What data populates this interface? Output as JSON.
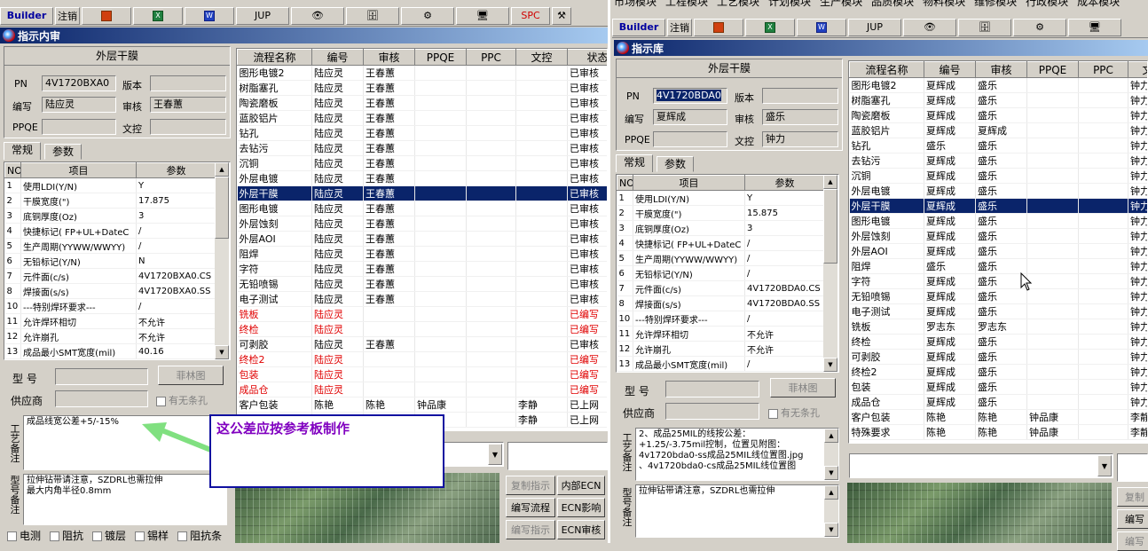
{
  "left": {
    "toolbar": {
      "builder": "Builder",
      "logout": "注销",
      "jup": "JUP",
      "spc": "SPC"
    },
    "window_title": "指示内审",
    "header_title": "外层干膜",
    "fields": {
      "pn_label": "PN",
      "pn_value": "4V1720BXA0",
      "version_label": "版本",
      "version_value": "",
      "writer_label": "编写",
      "writer_value": "陆应灵",
      "reviewer_label": "审核",
      "reviewer_value": "王春蕙",
      "ppqe_label": "PPQE",
      "ppqe_value": "",
      "doccontrol_label": "文控",
      "doccontrol_value": ""
    },
    "tabs": [
      "常规",
      "参数"
    ],
    "param_headers": [
      "NO",
      "项目",
      "参数"
    ],
    "params": [
      [
        "1",
        "使用LDI(Y/N)",
        "Y"
      ],
      [
        "2",
        "干膜宽度(\")",
        "17.875"
      ],
      [
        "3",
        "底铜厚度(Oz)",
        "3"
      ],
      [
        "4",
        "快捷标记( FP+UL+DateC",
        "/"
      ],
      [
        "5",
        "生产周期(YYWW/WWYY)",
        "/"
      ],
      [
        "6",
        "无铅标记(Y/N)",
        "N"
      ],
      [
        "7",
        "元件面(c/s)",
        "4V1720BXA0.CS"
      ],
      [
        "8",
        "焊接面(s/s)",
        "4V1720BXA0.SS"
      ],
      [
        "10",
        "---特别焊环要求---",
        "/"
      ],
      [
        "11",
        "允许焊环相切",
        "不允许"
      ],
      [
        "12",
        "允许崩孔",
        "不允许"
      ],
      [
        "13",
        "成品最小SMT宽度(mil)",
        "40.16"
      ]
    ],
    "model_label": "型 号",
    "model_value": "",
    "felin_button": "菲林图",
    "supplier_label": "供应商",
    "supplier_value": "",
    "nobar_label": "有无条孔",
    "process_note_label": "工艺备注",
    "process_note": "成品线宽公差+5/-15%",
    "model_note_label": "型号备注",
    "model_note": "拉伸钻带请注意，SZDRL也需拉伸\n最大内角半径0.8mm",
    "checkboxes": [
      "电测",
      "阻抗",
      "镀层",
      "锡样",
      "阻抗条"
    ],
    "flow_headers": [
      "流程名称",
      "编号",
      "审核",
      "PPQE",
      "PPC",
      "文控",
      "状态"
    ],
    "flow_rows": [
      {
        "cells": [
          "图形电镀2",
          "陆应灵",
          "王春蕙",
          "",
          "",
          "",
          "已审核"
        ],
        "state": "normal"
      },
      {
        "cells": [
          "树脂塞孔",
          "陆应灵",
          "王春蕙",
          "",
          "",
          "",
          "已审核"
        ],
        "state": "normal"
      },
      {
        "cells": [
          "陶瓷磨板",
          "陆应灵",
          "王春蕙",
          "",
          "",
          "",
          "已审核"
        ],
        "state": "normal"
      },
      {
        "cells": [
          "蓝胶铝片",
          "陆应灵",
          "王春蕙",
          "",
          "",
          "",
          "已审核"
        ],
        "state": "normal"
      },
      {
        "cells": [
          "钻孔",
          "陆应灵",
          "王春蕙",
          "",
          "",
          "",
          "已审核"
        ],
        "state": "normal"
      },
      {
        "cells": [
          "去钻污",
          "陆应灵",
          "王春蕙",
          "",
          "",
          "",
          "已审核"
        ],
        "state": "normal"
      },
      {
        "cells": [
          "沉铜",
          "陆应灵",
          "王春蕙",
          "",
          "",
          "",
          "已审核"
        ],
        "state": "normal"
      },
      {
        "cells": [
          "外层电镀",
          "陆应灵",
          "王春蕙",
          "",
          "",
          "",
          "已审核"
        ],
        "state": "normal"
      },
      {
        "cells": [
          "外层干膜",
          "陆应灵",
          "王春蕙",
          "",
          "",
          "",
          "已审核"
        ],
        "state": "selected"
      },
      {
        "cells": [
          "图形电镀",
          "陆应灵",
          "王春蕙",
          "",
          "",
          "",
          "已审核"
        ],
        "state": "normal"
      },
      {
        "cells": [
          "外层蚀刻",
          "陆应灵",
          "王春蕙",
          "",
          "",
          "",
          "已审核"
        ],
        "state": "normal"
      },
      {
        "cells": [
          "外层AOI",
          "陆应灵",
          "王春蕙",
          "",
          "",
          "",
          "已审核"
        ],
        "state": "normal"
      },
      {
        "cells": [
          "阻焊",
          "陆应灵",
          "王春蕙",
          "",
          "",
          "",
          "已审核"
        ],
        "state": "normal"
      },
      {
        "cells": [
          "字符",
          "陆应灵",
          "王春蕙",
          "",
          "",
          "",
          "已审核"
        ],
        "state": "normal"
      },
      {
        "cells": [
          "无铅喷锡",
          "陆应灵",
          "王春蕙",
          "",
          "",
          "",
          "已审核"
        ],
        "state": "normal"
      },
      {
        "cells": [
          "电子测试",
          "陆应灵",
          "王春蕙",
          "",
          "",
          "",
          "已审核"
        ],
        "state": "normal"
      },
      {
        "cells": [
          "铣板",
          "陆应灵",
          "",
          "",
          "",
          "",
          "已编写"
        ],
        "state": "red"
      },
      {
        "cells": [
          "终检",
          "陆应灵",
          "",
          "",
          "",
          "",
          "已编写"
        ],
        "state": "red"
      },
      {
        "cells": [
          "可剥胶",
          "陆应灵",
          "王春蕙",
          "",
          "",
          "",
          "已审核"
        ],
        "state": "normal"
      },
      {
        "cells": [
          "终检2",
          "陆应灵",
          "",
          "",
          "",
          "",
          "已编写"
        ],
        "state": "red"
      },
      {
        "cells": [
          "包装",
          "陆应灵",
          "",
          "",
          "",
          "",
          "已编写"
        ],
        "state": "red"
      },
      {
        "cells": [
          "成品仓",
          "陆应灵",
          "",
          "",
          "",
          "",
          "已编写"
        ],
        "state": "red"
      },
      {
        "cells": [
          "客户包装",
          "陈艳",
          "陈艳",
          "钟品康",
          "",
          "李静",
          "已上网"
        ],
        "state": "normal"
      },
      {
        "cells": [
          "",
          "",
          "",
          "",
          "",
          "李静",
          "已上网"
        ],
        "state": "normal"
      }
    ],
    "buttons": [
      "复制指示",
      "内部ECN",
      "编写流程",
      "ECN影响",
      "编写指示",
      "ECN审核"
    ]
  },
  "callout_text": "这公差应按参考板制作",
  "right": {
    "top_menu": [
      "市场模块",
      "工程模块",
      "工艺模块",
      "计划模块",
      "生产模块",
      "品质模块",
      "物料模块",
      "维修模块",
      "行政模块",
      "成本模块"
    ],
    "toolbar": {
      "builder": "Builder",
      "logout": "注销",
      "jup": "JUP"
    },
    "window_title": "指示库",
    "header_title": "外层干膜",
    "fields": {
      "pn_label": "PN",
      "pn_value": "4V1720BDA0",
      "version_label": "版本",
      "version_value": "",
      "writer_label": "编写",
      "writer_value": "夏辉成",
      "reviewer_label": "审核",
      "reviewer_value": "盛乐",
      "ppqe_label": "PPQE",
      "ppqe_value": "",
      "doccontrol_label": "文控",
      "doccontrol_value": "钟力"
    },
    "tabs": [
      "常规",
      "参数"
    ],
    "param_headers": [
      "NO",
      "项目",
      "参数"
    ],
    "params": [
      [
        "1",
        "使用LDI(Y/N)",
        "Y"
      ],
      [
        "2",
        "干膜宽度(\")",
        "15.875"
      ],
      [
        "3",
        "底铜厚度(Oz)",
        "3"
      ],
      [
        "4",
        "快捷标记( FP+UL+DateC",
        "/"
      ],
      [
        "5",
        "生产周期(YYWW/WWYY)",
        "/"
      ],
      [
        "6",
        "无铅标记(Y/N)",
        "/"
      ],
      [
        "7",
        "元件面(c/s)",
        "4V1720BDA0.CS"
      ],
      [
        "8",
        "焊接面(s/s)",
        "4V1720BDA0.SS"
      ],
      [
        "10",
        "---特别焊环要求---",
        "/"
      ],
      [
        "11",
        "允许焊环相切",
        "不允许"
      ],
      [
        "12",
        "允许崩孔",
        "不允许"
      ],
      [
        "13",
        "成品最小SMT宽度(mil)",
        "/"
      ]
    ],
    "model_label": "型 号",
    "felin_button": "菲林图",
    "supplier_label": "供应商",
    "nobar_label": "有无条孔",
    "process_note_label": "工艺备注",
    "process_note": "2、成品25MIL的线按公差：\n+1.25/-3.75mil控制，位置见附图：\n4v1720bda0-ss成品25MIL线位置图.jpg\n、4v1720bda0-cs成品25MIL线位置图",
    "model_note_label": "型号备注",
    "model_note": "拉伸钻带请注意，SZDRL也需拉伸",
    "flow_headers": [
      "流程名称",
      "编号",
      "审核",
      "PPQE",
      "PPC",
      "文控"
    ],
    "flow_rows": [
      {
        "cells": [
          "图形电镀2",
          "夏辉成",
          "盛乐",
          "",
          "",
          "钟力"
        ],
        "state": "normal"
      },
      {
        "cells": [
          "树脂塞孔",
          "夏辉成",
          "盛乐",
          "",
          "",
          "钟力"
        ],
        "state": "normal"
      },
      {
        "cells": [
          "陶瓷磨板",
          "夏辉成",
          "盛乐",
          "",
          "",
          "钟力"
        ],
        "state": "normal"
      },
      {
        "cells": [
          "蓝胶铝片",
          "夏辉成",
          "夏辉成",
          "",
          "",
          "钟力"
        ],
        "state": "normal"
      },
      {
        "cells": [
          "钻孔",
          "盛乐",
          "盛乐",
          "",
          "",
          "钟力"
        ],
        "state": "normal"
      },
      {
        "cells": [
          "去钻污",
          "夏辉成",
          "盛乐",
          "",
          "",
          "钟力"
        ],
        "state": "normal"
      },
      {
        "cells": [
          "沉铜",
          "夏辉成",
          "盛乐",
          "",
          "",
          "钟力"
        ],
        "state": "normal"
      },
      {
        "cells": [
          "外层电镀",
          "夏辉成",
          "盛乐",
          "",
          "",
          "钟力"
        ],
        "state": "normal"
      },
      {
        "cells": [
          "外层干膜",
          "夏辉成",
          "盛乐",
          "",
          "",
          "钟力"
        ],
        "state": "selected"
      },
      {
        "cells": [
          "图形电镀",
          "夏辉成",
          "盛乐",
          "",
          "",
          "钟力"
        ],
        "state": "normal"
      },
      {
        "cells": [
          "外层蚀刻",
          "夏辉成",
          "盛乐",
          "",
          "",
          "钟力"
        ],
        "state": "normal"
      },
      {
        "cells": [
          "外层AOI",
          "夏辉成",
          "盛乐",
          "",
          "",
          "钟力"
        ],
        "state": "normal"
      },
      {
        "cells": [
          "阻焊",
          "盛乐",
          "盛乐",
          "",
          "",
          "钟力"
        ],
        "state": "normal"
      },
      {
        "cells": [
          "字符",
          "夏辉成",
          "盛乐",
          "",
          "",
          "钟力"
        ],
        "state": "normal"
      },
      {
        "cells": [
          "无铅喷锡",
          "夏辉成",
          "盛乐",
          "",
          "",
          "钟力"
        ],
        "state": "normal"
      },
      {
        "cells": [
          "电子测试",
          "夏辉成",
          "盛乐",
          "",
          "",
          "钟力"
        ],
        "state": "normal"
      },
      {
        "cells": [
          "铣板",
          "罗志东",
          "罗志东",
          "",
          "",
          "钟力"
        ],
        "state": "normal"
      },
      {
        "cells": [
          "终检",
          "夏辉成",
          "盛乐",
          "",
          "",
          "钟力"
        ],
        "state": "normal"
      },
      {
        "cells": [
          "可剥胶",
          "夏辉成",
          "盛乐",
          "",
          "",
          "钟力"
        ],
        "state": "normal"
      },
      {
        "cells": [
          "终检2",
          "夏辉成",
          "盛乐",
          "",
          "",
          "钟力"
        ],
        "state": "normal"
      },
      {
        "cells": [
          "包装",
          "夏辉成",
          "盛乐",
          "",
          "",
          "钟力"
        ],
        "state": "normal"
      },
      {
        "cells": [
          "成品仓",
          "夏辉成",
          "盛乐",
          "",
          "",
          "钟力"
        ],
        "state": "normal"
      },
      {
        "cells": [
          "客户包装",
          "陈艳",
          "陈艳",
          "钟品康",
          "",
          "李静"
        ],
        "state": "normal"
      },
      {
        "cells": [
          "特殊要求",
          "陈艳",
          "陈艳",
          "钟品康",
          "",
          "李静"
        ],
        "state": "normal"
      }
    ],
    "buttons": [
      "复制",
      "编写",
      "编写"
    ]
  },
  "colors": {
    "selection": "#0a246a",
    "red_text": "#e00000",
    "title_bar": "#0a246a",
    "callout_border": "#1010a0",
    "callout_text": "#8000c0"
  }
}
